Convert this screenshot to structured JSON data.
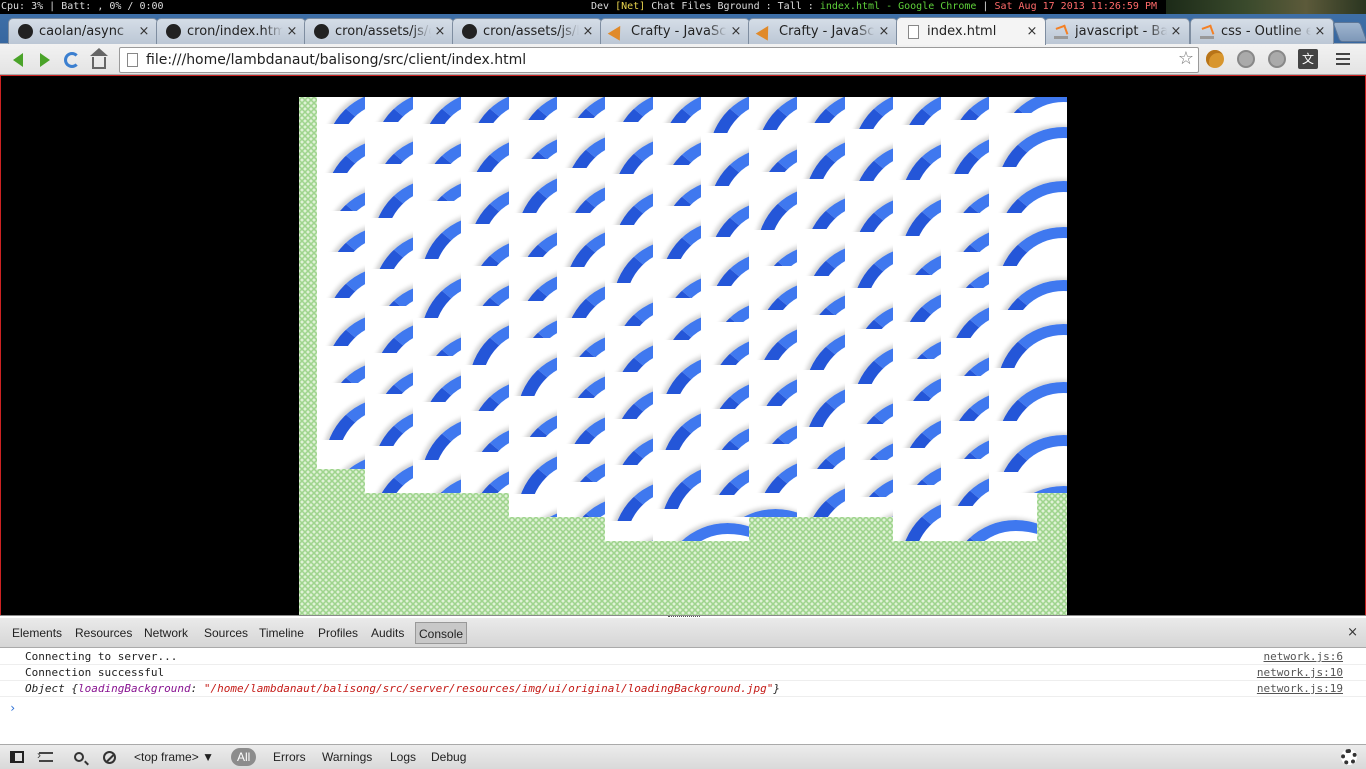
{
  "statusbar": {
    "left": "Cpu: 3% | Batt: , 0% / 0:00",
    "desktop": "Dev",
    "net": "[Net]",
    "rest": "Chat Files Bground : Tall :",
    "window_file": "index.html",
    "window_app": "- Google Chrome",
    "datetime": "Sat Aug 17 2013 11:26:59 PM"
  },
  "tabs": [
    {
      "label": "caolan/async",
      "icon": "github-icon"
    },
    {
      "label": "cron/index.htm",
      "icon": "github-icon"
    },
    {
      "label": "cron/assets/js/g",
      "icon": "github-icon"
    },
    {
      "label": "cron/assets/js/le",
      "icon": "github-icon"
    },
    {
      "label": "Crafty - JavaScr",
      "icon": "crafty-icon"
    },
    {
      "label": "Crafty - JavaScr",
      "icon": "crafty-icon"
    },
    {
      "label": "index.html",
      "icon": "document-icon",
      "active": true
    },
    {
      "label": "javascript - Bac",
      "icon": "stackoverflow-icon"
    },
    {
      "label": "css - Outline eff",
      "icon": "stackoverflow-icon"
    }
  ],
  "tab_close": "×",
  "toolbar": {
    "url": "file:///home/lambdanaut/balisong/src/client/index.html",
    "star": "☆",
    "translate": "文"
  },
  "game": {
    "tile_color": "#2456d8",
    "grass_color": "#9fd48e"
  },
  "devtools": {
    "tabs": [
      "Elements",
      "Resources",
      "Network",
      "Sources",
      "Timeline",
      "Profiles",
      "Audits",
      "Console"
    ],
    "selected_tab": "Console",
    "close": "×",
    "console": [
      {
        "text": "Connecting to server...",
        "source": "network.js:6"
      },
      {
        "text": "Connection successful",
        "source": "network.js:10"
      },
      {
        "prefix": "Object {",
        "key": "loadingBackground",
        "sep": ": ",
        "value": "\"/home/lambdanaut/balisong/src/server/resources/img/ui/original/loadingBackground.jpg\"",
        "suffix": "}",
        "source": "network.js:19"
      }
    ],
    "prompt": "›",
    "frame": "<top frame>",
    "frame_arrow": "▼",
    "filters": [
      "All",
      "Errors",
      "Warnings",
      "Logs",
      "Debug"
    ],
    "selected_filter": "All"
  }
}
